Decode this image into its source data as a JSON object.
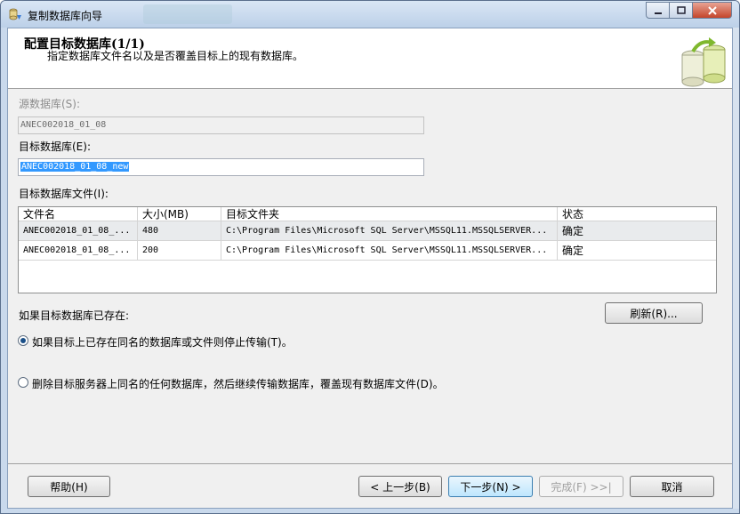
{
  "window": {
    "title": "复制数据库向导"
  },
  "header": {
    "title": "配置目标数据库(1/1)",
    "subtitle": "指定数据库文件名以及是否覆盖目标上的现有数据库。"
  },
  "source": {
    "label": "源数据库(S):",
    "value": "ANEC002018_01_08"
  },
  "target": {
    "label": "目标数据库(E):",
    "value": "ANEC002018_01_08_new"
  },
  "files": {
    "label": "目标数据库文件(I):",
    "columns": [
      "文件名",
      "大小(MB)",
      "目标文件夹",
      "状态"
    ],
    "rows": [
      [
        "ANEC002018_01_08_...",
        "480",
        "C:\\Program Files\\Microsoft SQL Server\\MSSQL11.MSSQLSERVER...",
        "确定"
      ],
      [
        "ANEC002018_01_08_...",
        "200",
        "C:\\Program Files\\Microsoft SQL Server\\MSSQL11.MSSQLSERVER...",
        "确定"
      ]
    ]
  },
  "exists": {
    "label": "如果目标数据库已存在:",
    "refresh": "刷新(R)...",
    "option_stop": "如果目标上已存在同名的数据库或文件则停止传输(T)。",
    "option_drop": "删除目标服务器上同名的任何数据库，然后继续传输数据库，覆盖现有数据库文件(D)。",
    "selected": "stop"
  },
  "buttons": {
    "help": "帮助(H)",
    "back": "< 上一步(B)",
    "next": "下一步(N) >",
    "finish": "完成(F) >>|",
    "cancel": "取消"
  }
}
